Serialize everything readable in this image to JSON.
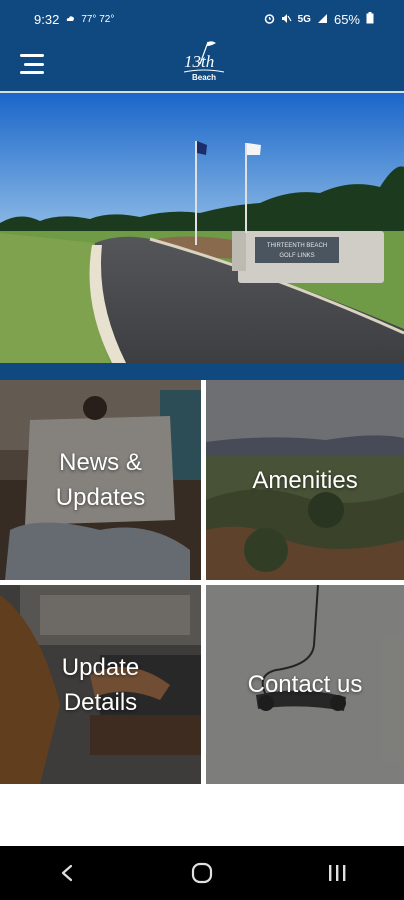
{
  "status_bar": {
    "time": "9:32",
    "weather": "77° 72°",
    "network": "5G",
    "battery": "65%"
  },
  "header": {
    "logo_number": "13th",
    "logo_word": "Beach",
    "menu_icon": "hamburger-menu-icon",
    "color": "#10497f"
  },
  "hero": {
    "sign_line1": "THIRTEENTH BEACH",
    "sign_line2": "GOLF LINKS"
  },
  "tiles": [
    {
      "label": "News &\nUpdates",
      "icon": "newspaper-photo"
    },
    {
      "label": "Amenities",
      "icon": "landscape-photo"
    },
    {
      "label": "Update\nDetails",
      "icon": "laptop-photo"
    },
    {
      "label": "Contact us",
      "icon": "phone-photo"
    }
  ],
  "nav": {
    "back_icon": "back-icon",
    "home_icon": "home-icon",
    "recents_icon": "recents-icon"
  }
}
